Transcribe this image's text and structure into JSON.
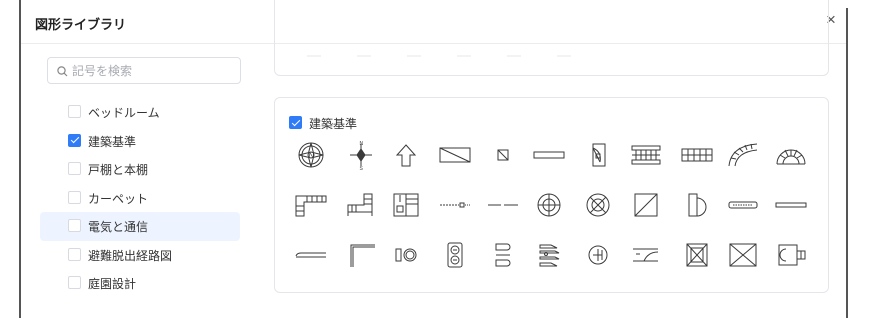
{
  "dialog": {
    "title": "図形ライブラリ",
    "close_glyph": "×"
  },
  "search": {
    "placeholder": "記号を検索",
    "value": "",
    "icon": "search-icon"
  },
  "categories": [
    {
      "label": "ベッドルーム",
      "checked": false,
      "active": false
    },
    {
      "label": "建築基準",
      "checked": true,
      "active": false
    },
    {
      "label": "戸棚と本棚",
      "checked": false,
      "active": false
    },
    {
      "label": "カーペット",
      "checked": false,
      "active": false
    },
    {
      "label": "電気と通信",
      "checked": false,
      "active": true
    },
    {
      "label": "避難脱出経路図",
      "checked": false,
      "active": false
    },
    {
      "label": "庭園設計",
      "checked": false,
      "active": false
    }
  ],
  "section": {
    "label": "建築基準",
    "checked": true
  },
  "symbols": [
    [
      "compass-rose-icon",
      "north-arrow-icon",
      "up-arrow-icon",
      "diagonal-rectangle-icon",
      "small-square-icon",
      "flat-rectangle-icon",
      "door-swing-icon",
      "window-railing-icon",
      "wall-rail-icon",
      "curved-stair-icon",
      "spiral-stair-icon"
    ],
    [
      "l-stair-left-icon",
      "l-stair-right-icon",
      "stair-landing-icon",
      "dashed-line-icon",
      "short-dash-line-icon",
      "circle-grid-icon",
      "circle-cross-icon",
      "diagonal-square-icon",
      "half-circle-door-icon",
      "vent-grille-icon",
      "thin-bar-icon"
    ],
    [
      "beam-line-icon",
      "corner-wall-icon",
      "double-circle-icon",
      "socket-pair-icon",
      "rounded-slot-icon",
      "stacked-fixture-icon",
      "circle-plus-icon",
      "ramp-icon",
      "crossed-square-icon",
      "crossed-box-icon",
      "wc-fixture-icon"
    ]
  ],
  "colors": {
    "accent": "#2f7cf6",
    "active_bg": "#eef4ff",
    "border": "#e4e6eb"
  }
}
